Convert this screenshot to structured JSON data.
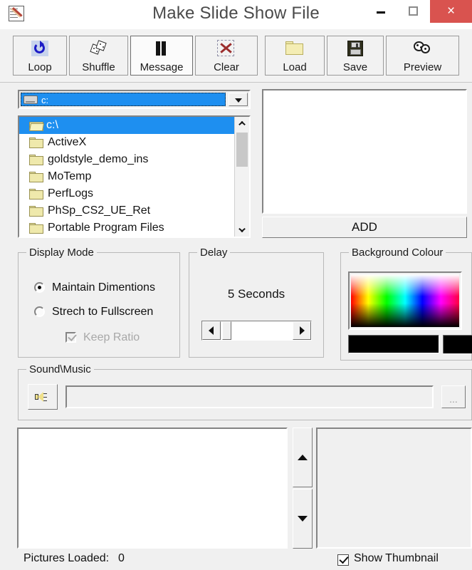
{
  "window": {
    "title": "Make Slide Show File",
    "icon": "notepad-pencil-icon",
    "controls": {
      "minimize": "minimize-icon",
      "maximize": "maximize-icon",
      "close": "×"
    }
  },
  "toolbar": {
    "buttons": [
      {
        "label": "Loop",
        "icon": "loop-icon",
        "pressed": false
      },
      {
        "label": "Shuffle",
        "icon": "shuffle-dice-icon",
        "pressed": false
      },
      {
        "label": "Message",
        "icon": "pause-icon",
        "pressed": true
      },
      {
        "label": "Clear",
        "icon": "clear-red-x-icon",
        "pressed": false
      },
      {
        "label": "Load",
        "icon": "folder-open-icon",
        "pressed": false
      },
      {
        "label": "Save",
        "icon": "floppy-disk-icon",
        "pressed": false
      },
      {
        "label": "Preview",
        "icon": "preview-circles-icon",
        "pressed": false
      }
    ]
  },
  "drive_combo": {
    "selected": "c:",
    "icon": "drive-icon",
    "arrow": "chevron-down-icon"
  },
  "folder_list": {
    "items": [
      {
        "label": "c:\\",
        "selected": true
      },
      {
        "label": "ActiveX",
        "selected": false
      },
      {
        "label": "goldstyle_demo_ins",
        "selected": false
      },
      {
        "label": "MoTemp",
        "selected": false
      },
      {
        "label": "PerfLogs",
        "selected": false
      },
      {
        "label": "PhSp_CS2_UE_Ret",
        "selected": false
      },
      {
        "label": "Portable Program Files",
        "selected": false
      }
    ]
  },
  "add_button": {
    "label": "ADD"
  },
  "display_mode": {
    "title": "Display Mode",
    "options": [
      {
        "label": "Maintain Dimentions",
        "selected": true
      },
      {
        "label": "Strech to Fullscreen",
        "selected": false
      }
    ],
    "keep_ratio": {
      "label": "Keep Ratio",
      "checked": true,
      "disabled": true
    }
  },
  "delay": {
    "title": "Delay",
    "value_text": "5 Seconds",
    "left_arrow": "left-arrow-icon",
    "right_arrow": "right-arrow-icon"
  },
  "background_colour": {
    "title": "Background Colour",
    "selected_color": "#000000",
    "preview_color": "#000000"
  },
  "sound": {
    "title": "Sound\\Music",
    "speaker_icon": "speaker-icon",
    "path_value": "",
    "browse_label": "..."
  },
  "bottom": {
    "move_up": "up-arrow-icon",
    "move_down": "down-arrow-icon"
  },
  "status": {
    "pictures_loaded_label": "Pictures Loaded:",
    "pictures_loaded_count": "0",
    "show_thumbnail_label": "Show Thumbnail",
    "show_thumbnail_checked": true
  }
}
